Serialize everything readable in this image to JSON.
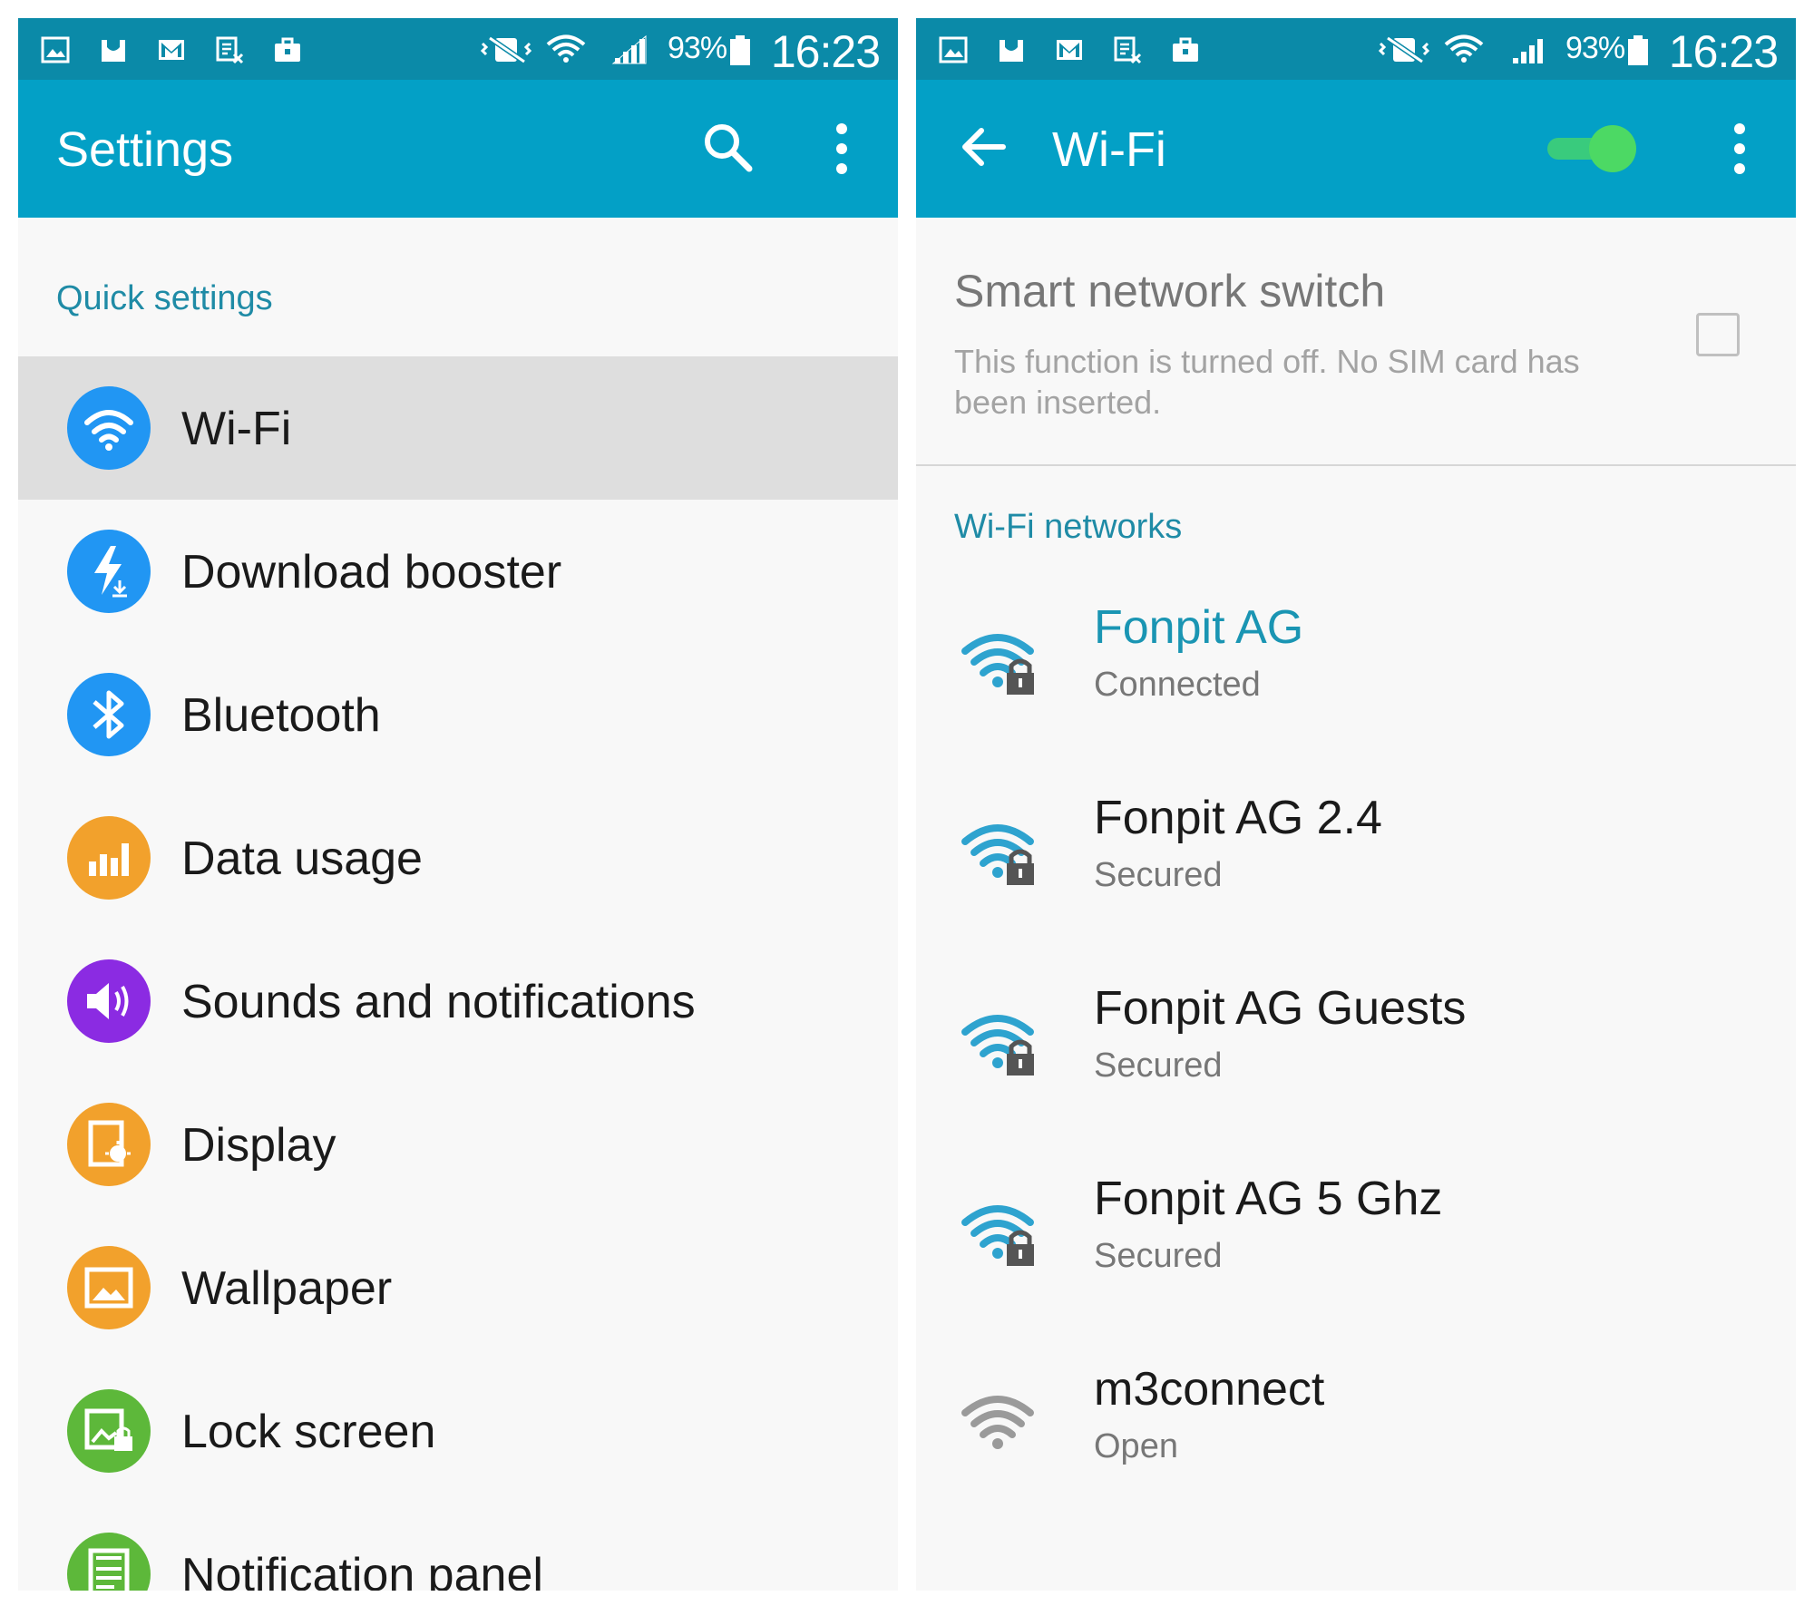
{
  "status_bar": {
    "battery_percent": "93%",
    "time": "16:23",
    "notification_icons": [
      "gallery-icon",
      "galaxy-apps-icon",
      "gmail-icon",
      "tasks-icon",
      "briefcase-icon"
    ],
    "system_icons": [
      "vibrate-icon",
      "wifi-status-icon",
      "signal-icon",
      "battery-icon"
    ]
  },
  "settings_screen": {
    "title": "Settings",
    "actions": [
      "search-icon",
      "more-vert-icon"
    ],
    "section_header": "Quick settings",
    "items": [
      {
        "label": "Wi-Fi",
        "icon": "wifi-icon",
        "color": "#2196f3",
        "selected": true
      },
      {
        "label": "Download booster",
        "icon": "download-booster-icon",
        "color": "#2196f3"
      },
      {
        "label": "Bluetooth",
        "icon": "bluetooth-icon",
        "color": "#2196f3"
      },
      {
        "label": "Data usage",
        "icon": "data-usage-icon",
        "color": "#f2a12c"
      },
      {
        "label": "Sounds and notifications",
        "icon": "sound-icon",
        "color": "#8b2be2"
      },
      {
        "label": "Display",
        "icon": "display-icon",
        "color": "#f2a12c"
      },
      {
        "label": "Wallpaper",
        "icon": "wallpaper-icon",
        "color": "#f2a12c"
      },
      {
        "label": "Lock screen",
        "icon": "lock-screen-icon",
        "color": "#5db83a"
      },
      {
        "label": "Notification panel",
        "icon": "notification-panel-icon",
        "color": "#5db83a"
      }
    ]
  },
  "wifi_screen": {
    "title": "Wi-Fi",
    "wifi_enabled": true,
    "toggle_color": "#4cd964",
    "smart_network_switch": {
      "title": "Smart network switch",
      "description": "This function is turned off. No SIM card has been inserted.",
      "checked": false
    },
    "section_header": "Wi-Fi networks",
    "networks": [
      {
        "name": "Fonpit AG",
        "status": "Connected",
        "secured": true,
        "connected": true
      },
      {
        "name": "Fonpit AG 2.4",
        "status": "Secured",
        "secured": true,
        "connected": false
      },
      {
        "name": "Fonpit AG Guests",
        "status": "Secured",
        "secured": true,
        "connected": false
      },
      {
        "name": "Fonpit AG 5 Ghz",
        "status": "Secured",
        "secured": true,
        "connected": false
      },
      {
        "name": "m3connect",
        "status": "Open",
        "secured": false,
        "connected": false
      }
    ]
  },
  "colors": {
    "status_bar": "#0b8aa8",
    "app_bar": "#03a0c6",
    "accent_text": "#1f8ba6",
    "wifi_active": "#2ea3cf",
    "wifi_inactive": "#9a9a9a"
  }
}
